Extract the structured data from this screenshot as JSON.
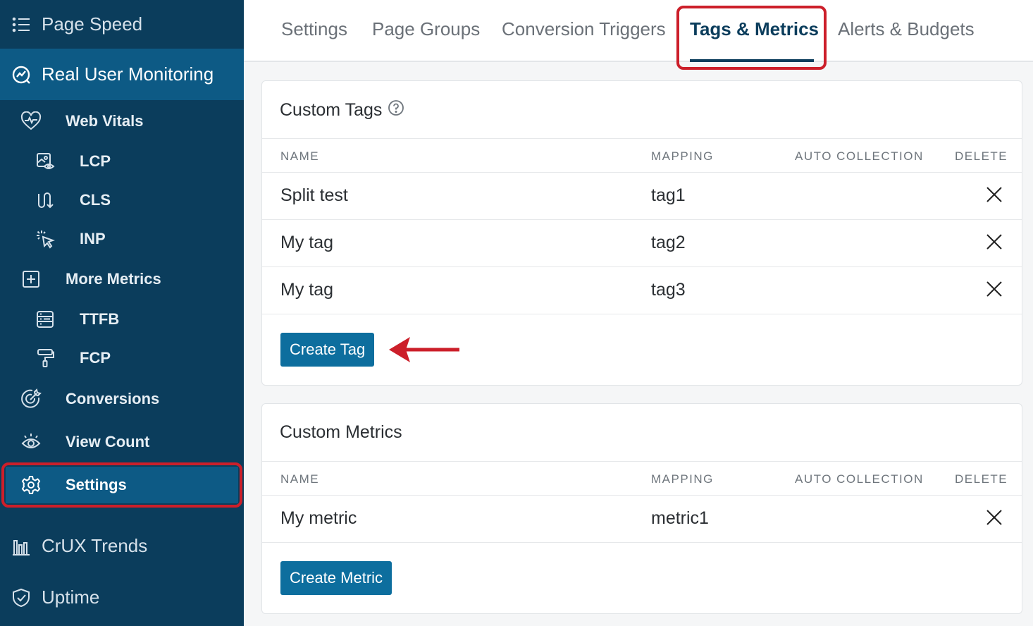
{
  "sidebar": {
    "page_speed": "Page Speed",
    "rum": "Real User Monitoring",
    "web_vitals": "Web Vitals",
    "lcp": "LCP",
    "cls": "CLS",
    "inp": "INP",
    "more_metrics": "More Metrics",
    "ttfb": "TTFB",
    "fcp": "FCP",
    "conversions": "Conversions",
    "view_count": "View Count",
    "settings": "Settings",
    "crux_trends": "CrUX Trends",
    "uptime": "Uptime"
  },
  "tabs": [
    "Settings",
    "Page Groups",
    "Conversion Triggers",
    "Tags & Metrics",
    "Alerts & Budgets"
  ],
  "active_tab": "Tags & Metrics",
  "custom_tags": {
    "title": "Custom Tags",
    "headers": {
      "name": "NAME",
      "mapping": "MAPPING",
      "auto": "AUTO COLLECTION",
      "delete": "DELETE"
    },
    "rows": [
      {
        "name": "Split test",
        "mapping": "tag1"
      },
      {
        "name": "My tag",
        "mapping": "tag2"
      },
      {
        "name": "My tag",
        "mapping": "tag3"
      }
    ],
    "button": "Create Tag"
  },
  "custom_metrics": {
    "title": "Custom Metrics",
    "headers": {
      "name": "NAME",
      "mapping": "MAPPING",
      "auto": "AUTO COLLECTION",
      "delete": "DELETE"
    },
    "rows": [
      {
        "name": "My metric",
        "mapping": "metric1"
      }
    ],
    "button": "Create Metric"
  },
  "colors": {
    "sidebar": "#0b3d5c",
    "accent": "#0d6e9e",
    "highlight": "#cc1f2a"
  }
}
